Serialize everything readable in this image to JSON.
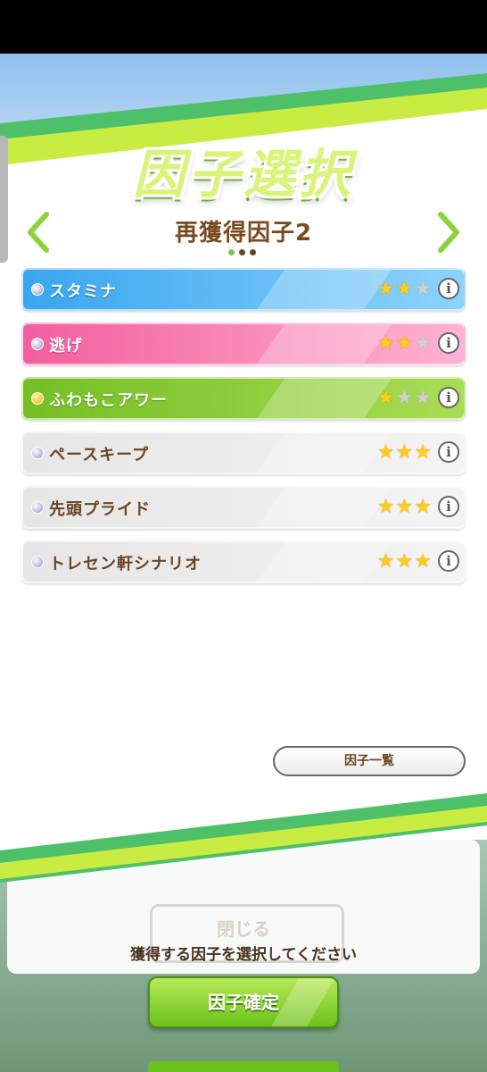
{
  "header": {
    "title": "因子選択",
    "subtitle": "再獲得因子2",
    "page_dots": {
      "count": 3,
      "active": 1
    }
  },
  "colors": {
    "blue": "#3faef0",
    "pink": "#f56fa8",
    "green": "#7ec72e",
    "gray": "#e3e3e3",
    "brown_text": "#6b4423"
  },
  "factors": [
    {
      "name": "スタミナ",
      "stars": 2,
      "max_stars": 3,
      "color": "blue",
      "bullet": "silver"
    },
    {
      "name": "逃げ",
      "stars": 2,
      "max_stars": 3,
      "color": "pink",
      "bullet": "silver"
    },
    {
      "name": "ふわもこアワー",
      "stars": 1,
      "max_stars": 3,
      "color": "green",
      "bullet": "gold"
    },
    {
      "name": "ペースキープ",
      "stars": 3,
      "max_stars": 3,
      "color": "gray",
      "bullet": "silver"
    },
    {
      "name": "先頭プライド",
      "stars": 3,
      "max_stars": 3,
      "color": "gray",
      "bullet": "silver"
    },
    {
      "name": "トレセン軒シナリオ",
      "stars": 3,
      "max_stars": 3,
      "color": "gray",
      "bullet": "silver"
    }
  ],
  "icons": {
    "prev": "chevron-left-icon",
    "next": "chevron-right-icon",
    "info": "info-icon",
    "star": "star-icon"
  },
  "buttons": {
    "factor_list": "因子一覧",
    "close_background": "閉じる",
    "confirm": "因子確定"
  },
  "prompt": "獲得する因子を選択してください"
}
